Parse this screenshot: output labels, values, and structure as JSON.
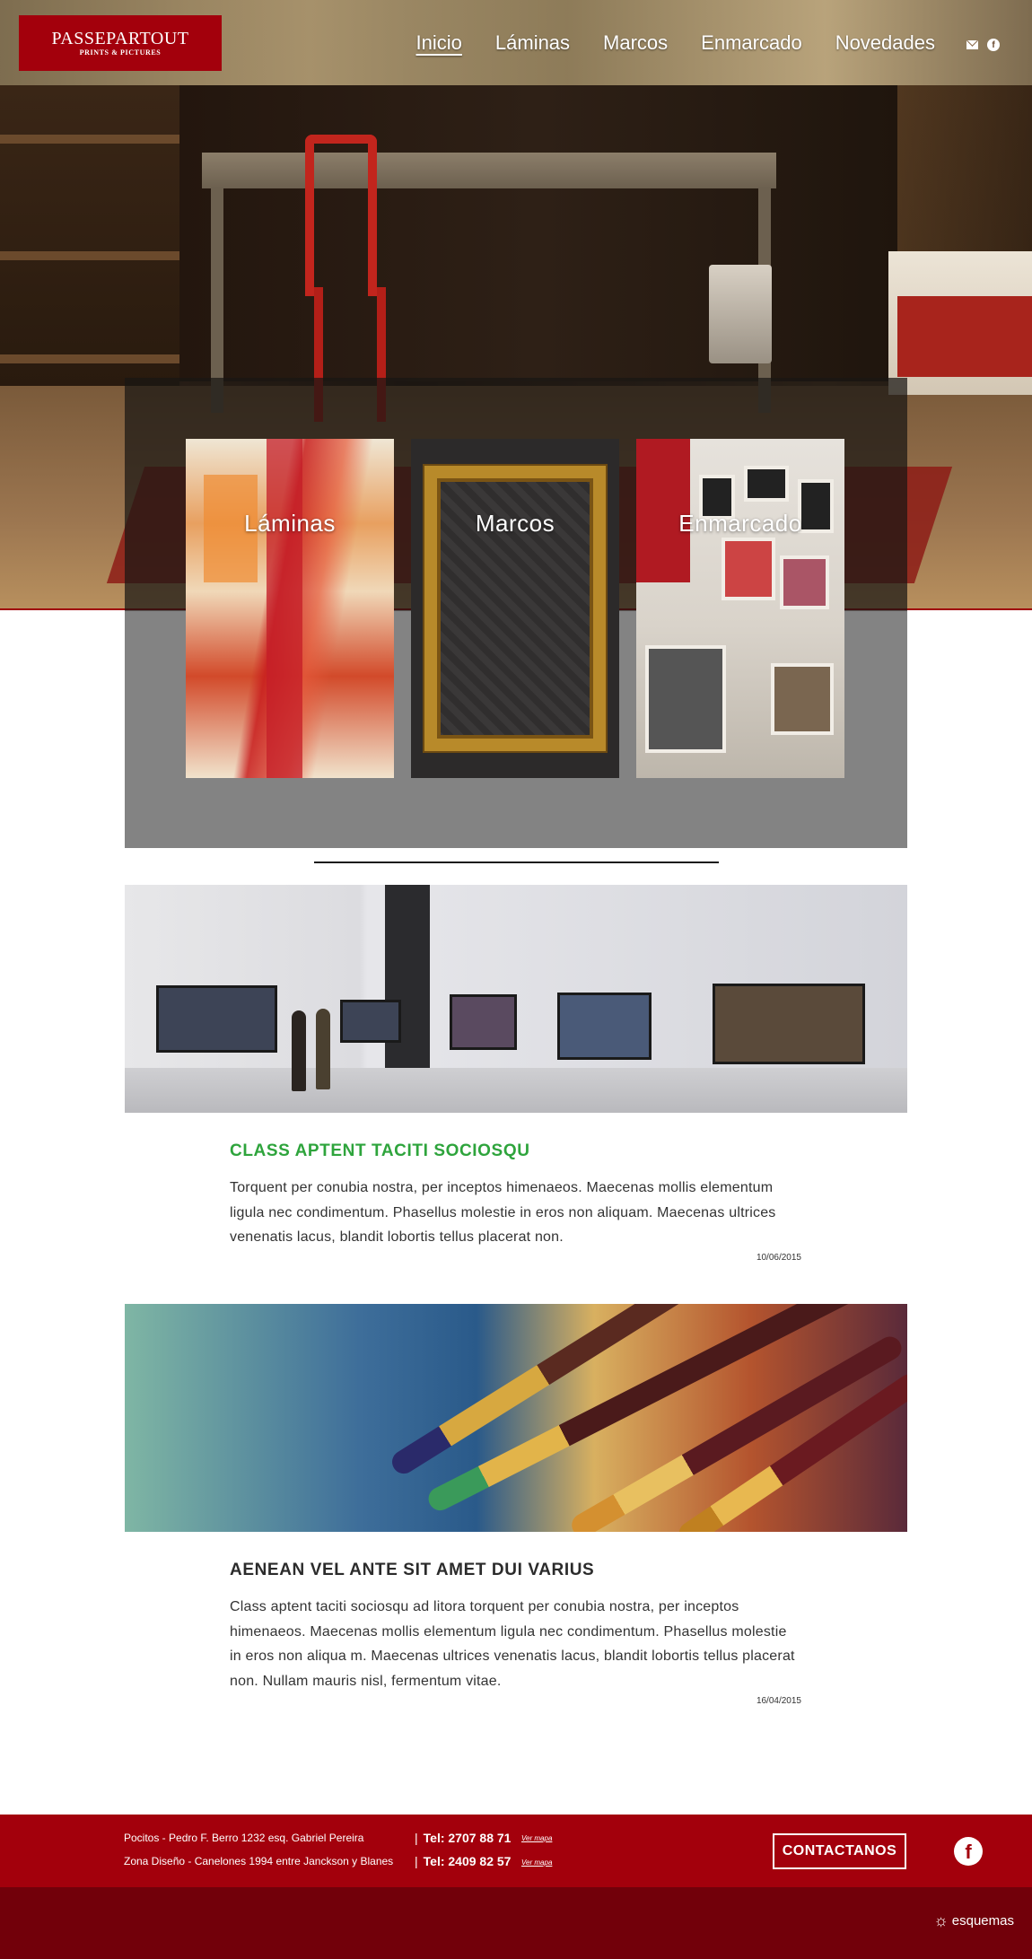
{
  "header": {
    "logo_brand": "PASSEPARTOUT",
    "logo_sub": "PRINTS & PICTURES",
    "nav": [
      {
        "label": "Inicio",
        "active": true
      },
      {
        "label": "Láminas",
        "active": false
      },
      {
        "label": "Marcos",
        "active": false
      },
      {
        "label": "Enmarcado",
        "active": false
      },
      {
        "label": "Novedades",
        "active": false
      }
    ],
    "social_icons": [
      "mail-icon",
      "facebook-icon"
    ]
  },
  "categories": [
    {
      "label": "Láminas"
    },
    {
      "label": "Marcos"
    },
    {
      "label": "Enmarcado"
    }
  ],
  "articles": [
    {
      "title": "CLASS APTENT TACITI SOCIOSQU",
      "body": "Torquent per conubia nostra, per inceptos himenaeos. Maecenas mollis elementum ligula nec condimentum. Phasellus molestie in eros non aliquam. Maecenas ultrices venenatis lacus, blandit lobortis tellus placerat non.",
      "date": "10/06/2015",
      "title_color": "#2ea43c"
    },
    {
      "title": "AENEAN VEL ANTE SIT AMET DUI VARIUS",
      "body": "Class aptent taciti sociosqu ad litora torquent per conubia nostra, per inceptos himenaeos. Maecenas mollis elementum ligula nec condimentum. Phasellus molestie in eros non aliqua m. Maecenas ultrices venenatis lacus, blandit lobortis tellus placerat non. Nullam mauris nisl, fermentum vitae.",
      "date": "16/04/2015",
      "title_color": "#2b2b2b"
    }
  ],
  "footer": {
    "address_1": "Pocitos - Pedro F. Berro 1232 esq. Gabriel Pereira",
    "address_2": "Zona Diseño - Canelones 1994 entre Janckson y Blanes",
    "pipe": "|",
    "tel_1": "Tel: 2707 88 71",
    "tel_2": "Tel: 2409 82 57",
    "map_link": "Ver mapa",
    "contact_button": "CONTACTANOS",
    "credit": "esquemas"
  },
  "colors": {
    "brand_red": "#a3000c",
    "footer_dark": "#72000a",
    "accent_green": "#2ea43c"
  }
}
